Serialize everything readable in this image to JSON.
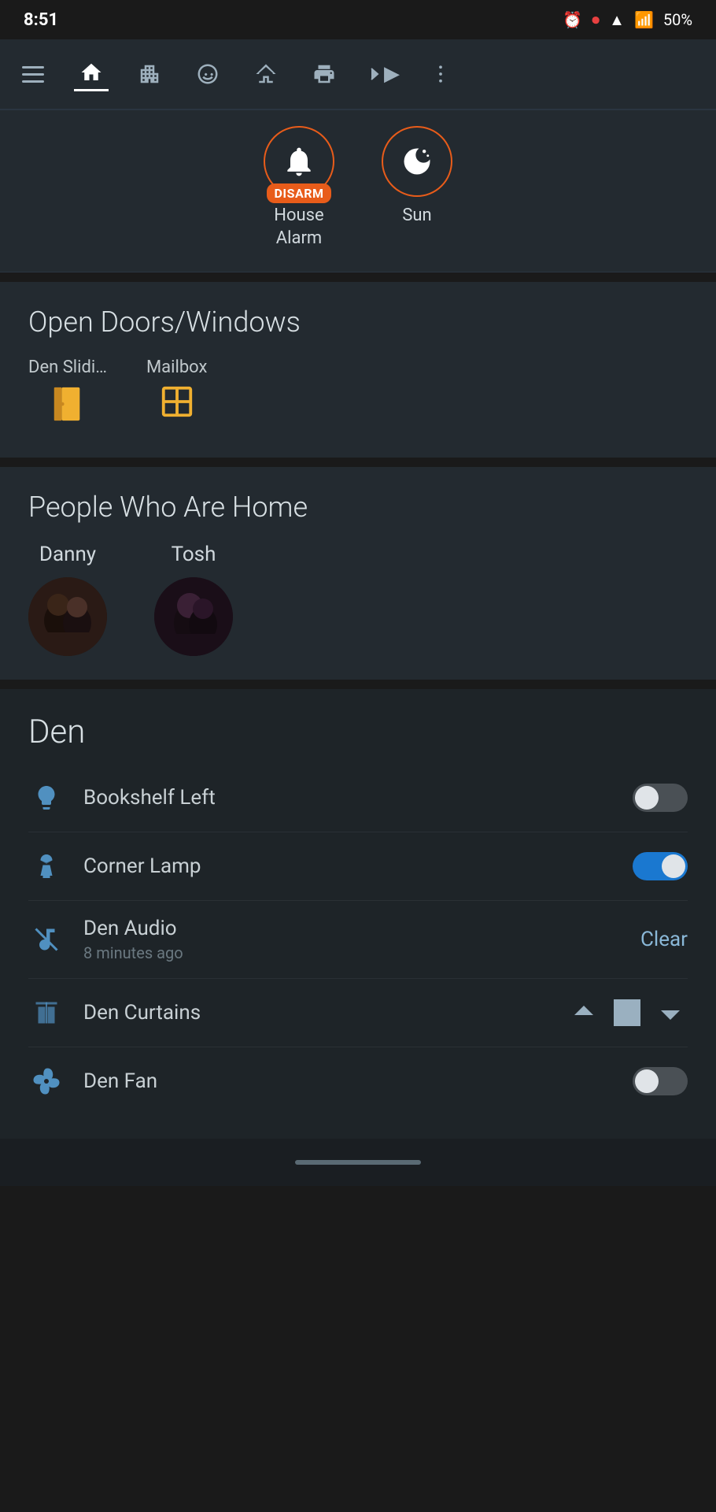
{
  "statusBar": {
    "time": "8:51",
    "batteryPct": "50%"
  },
  "navbar": {
    "items": [
      {
        "name": "menu",
        "label": "Menu",
        "icon": "hamburger",
        "active": false
      },
      {
        "name": "home",
        "label": "Home",
        "icon": "home",
        "active": true
      },
      {
        "name": "building",
        "label": "Building",
        "icon": "building",
        "active": false
      },
      {
        "name": "face",
        "label": "Face",
        "icon": "face",
        "active": false
      },
      {
        "name": "house2",
        "label": "House2",
        "icon": "house2",
        "active": false
      },
      {
        "name": "print",
        "label": "Print",
        "icon": "print",
        "active": false
      },
      {
        "name": "next",
        "label": "Next",
        "icon": "arrow",
        "active": false
      },
      {
        "name": "more",
        "label": "More",
        "icon": "dots",
        "active": false
      }
    ]
  },
  "quickActions": {
    "alarm": {
      "label1": "House",
      "label2": "Alarm",
      "badge": "DISARM",
      "icon": "bell"
    },
    "sun": {
      "label": "Sun",
      "icon": "moon-star"
    }
  },
  "openDoorsWindows": {
    "title": "Open Doors/Windows",
    "items": [
      {
        "name": "Den Slidi…",
        "icon": "door-open"
      },
      {
        "name": "Mailbox",
        "icon": "window"
      }
    ]
  },
  "peopleHome": {
    "title": "People Who Are Home",
    "people": [
      {
        "name": "Danny"
      },
      {
        "name": "Tosh"
      }
    ]
  },
  "den": {
    "title": "Den",
    "devices": [
      {
        "name": "Bookshelf Left",
        "icon": "bulb",
        "control": "toggle-off"
      },
      {
        "name": "Corner Lamp",
        "icon": "lamp",
        "control": "toggle-on"
      },
      {
        "name": "Den Audio",
        "subtitle": "8 minutes ago",
        "icon": "music-off",
        "control": "clear",
        "controlLabel": "Clear"
      },
      {
        "name": "Den Curtains",
        "icon": "curtains",
        "control": "curtain"
      },
      {
        "name": "Den Fan",
        "icon": "fan",
        "control": "toggle-off"
      }
    ]
  },
  "bottomBar": {
    "indicator": "home"
  }
}
